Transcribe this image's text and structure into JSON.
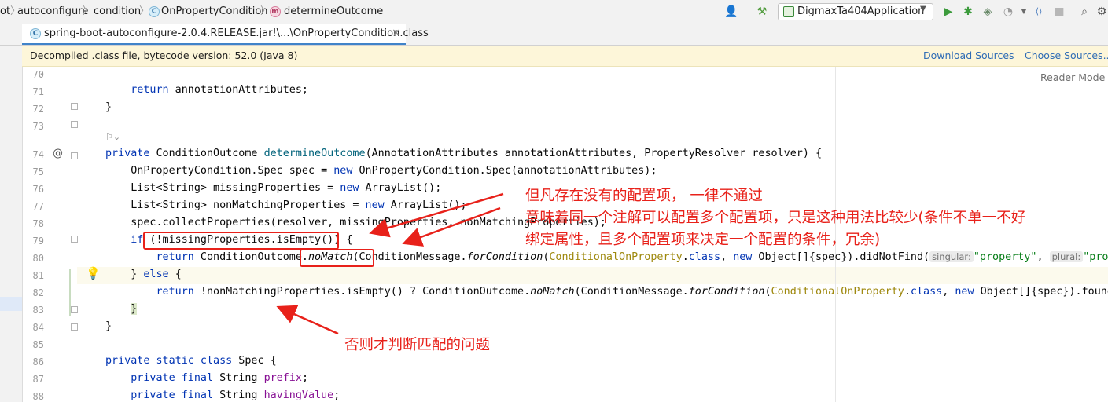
{
  "breadcrumbs": {
    "items": [
      "ot",
      "autoconfigure",
      "condition",
      "OnPropertyCondition",
      "determineOutcome"
    ]
  },
  "toolbar": {
    "run_config": "DigmaxTa404Application"
  },
  "tab": {
    "label": "spring-boot-autoconfigure-2.0.4.RELEASE.jar!\\...\\OnPropertyCondition.class",
    "close": "×"
  },
  "banner": {
    "text": "Decompiled .class file, bytecode version: 52.0 (Java 8)",
    "download": "Download Sources",
    "choose": "Choose Sources..."
  },
  "editor": {
    "reader_mode": "Reader Mode",
    "line_numbers": [
      "70",
      "71",
      "72",
      "73",
      "74",
      "75",
      "76",
      "77",
      "78",
      "79",
      "80",
      "81",
      "82",
      "83",
      "84",
      "85",
      "86",
      "87",
      "88"
    ],
    "hints": {
      "singular": "singular:",
      "plural": "plural:"
    }
  },
  "annotations": {
    "note1": "但凡存在没有的配置项，  一律不通过",
    "note2": "意味着同一个注解可以配置多个配置项，只是这种用法比较少(条件不单一不好",
    "note3": "绑定属性，且多个配置项来决定一个配置的条件，冗余)",
    "note4": "否则才判断匹配的问题"
  },
  "colors": {
    "annotation_red": "#e8211a",
    "keyword": "#0033b3",
    "string": "#067d17",
    "link": "#2f6cb5"
  }
}
